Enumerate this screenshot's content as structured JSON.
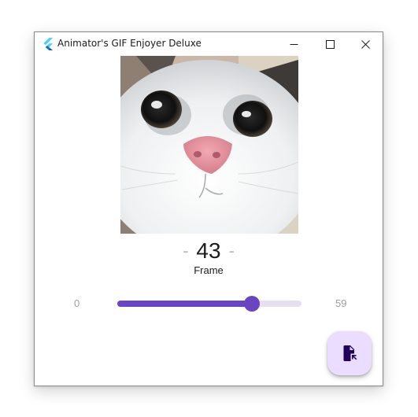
{
  "window": {
    "title": "Animator's GIF Enjoyer Deluxe"
  },
  "frame": {
    "dash_left": "-",
    "number": "43",
    "dash_right": "-",
    "label": "Frame"
  },
  "slider": {
    "min_label": "0",
    "max_label": "59",
    "min": 0,
    "max": 59,
    "value": 43
  },
  "fab": {
    "icon": "open-file-icon"
  },
  "colors": {
    "accent": "#6a45c2",
    "track_inactive": "#e6dff0",
    "fab_background": "#eaddff",
    "fab_icon": "#21005d",
    "flutter_blue_light": "#45d1fd",
    "flutter_blue_dark": "#0277bd"
  }
}
